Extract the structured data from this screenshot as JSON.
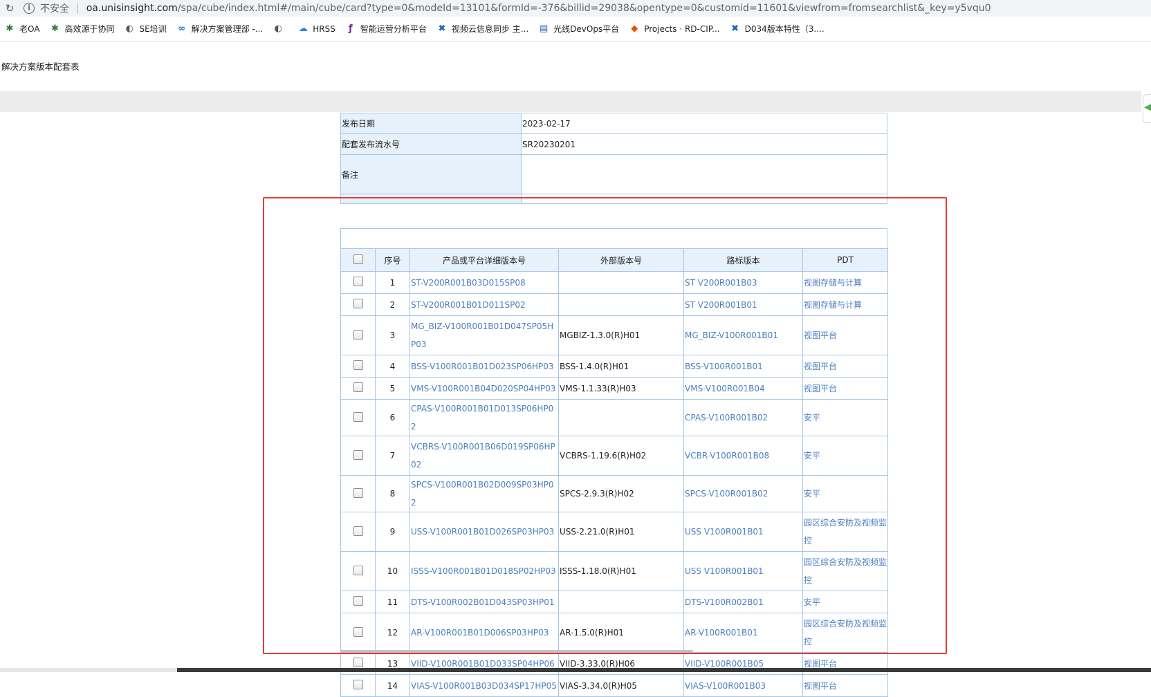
{
  "browser": {
    "insecure_label": "不安全",
    "url_host": "oa.unisinsight.com",
    "url_path": "/spa/cube/index.html#/main/cube/card?type=0&modeId=13101&formId=-376&billid=29038&opentype=0&customid=11601&viewfrom=fromsearchlist&_key=y5vqu0",
    "bookmarks": [
      {
        "label": "老OA",
        "icon": "gear-green-icon"
      },
      {
        "label": "高效源于协同",
        "icon": "gear-green-icon"
      },
      {
        "label": "SE培训",
        "icon": "globe-icon"
      },
      {
        "label": "解决方案管理部 -...",
        "icon": "infinity-icon"
      },
      {
        "label": "",
        "icon": "globe-icon"
      },
      {
        "label": "HRSS",
        "icon": "cloud-icon"
      },
      {
        "label": "智能运营分析平台",
        "icon": "brand-icon"
      },
      {
        "label": "视频云信息同步 主...",
        "icon": "confluence-icon"
      },
      {
        "label": "光线DevOps平台",
        "icon": "doc-icon"
      },
      {
        "label": "Projects · RD-CIP...",
        "icon": "gitlab-icon"
      },
      {
        "label": "D034版本特性（3....",
        "icon": "confluence-icon"
      }
    ]
  },
  "page": {
    "title": "解决方案版本配套表"
  },
  "info": {
    "rows": [
      {
        "label": "发布日期",
        "value": "2023-02-17"
      },
      {
        "label": "配套发布流水号",
        "value": "SR20230201"
      },
      {
        "label": "备注",
        "value": ""
      }
    ]
  },
  "detail": {
    "headers": [
      "序号",
      "产品或平台详细版本号",
      "外部版本号",
      "路标版本",
      "PDT"
    ],
    "rows": [
      {
        "no": "1",
        "product": "ST-V200R001B03D015SP08",
        "external": "",
        "roadmap": "ST V200R001B03",
        "pdt": "视图存储与计算"
      },
      {
        "no": "2",
        "product": "ST-V200R001B01D011SP02",
        "external": "",
        "roadmap": "ST V200R001B01",
        "pdt": "视图存储与计算"
      },
      {
        "no": "3",
        "product": "MG_BIZ-V100R001B01D047SP05HP03",
        "external": "MGBIZ-1.3.0(R)H01",
        "roadmap": "MG_BIZ-V100R001B01",
        "pdt": "视图平台"
      },
      {
        "no": "4",
        "product": "BSS-V100R001B01D023SP06HP03",
        "external": "BSS-1.4.0(R)H01",
        "roadmap": "BSS-V100R001B01",
        "pdt": "视图平台"
      },
      {
        "no": "5",
        "product": "VMS-V100R001B04D020SP04HP03",
        "external": "VMS-1.1.33(R)H03",
        "roadmap": "VMS-V100R001B04",
        "pdt": "视图平台"
      },
      {
        "no": "6",
        "product": "CPAS-V100R001B01D013SP06HP02",
        "external": "",
        "roadmap": "CPAS-V100R001B02",
        "pdt": "安平"
      },
      {
        "no": "7",
        "product": "VCBRS-V100R001B06D019SP06HP02",
        "external": "VCBRS-1.19.6(R)H02",
        "roadmap": "VCBR-V100R001B08",
        "pdt": "安平"
      },
      {
        "no": "8",
        "product": "SPCS-V100R001B02D009SP03HP02",
        "external": "SPCS-2.9.3(R)H02",
        "roadmap": "SPCS-V100R001B02",
        "pdt": "安平"
      },
      {
        "no": "9",
        "product": "USS-V100R001B01D026SP03HP03",
        "external": "USS-2.21.0(R)H01",
        "roadmap": "USS V100R001B01",
        "pdt": "园区综合安防及视频监控"
      },
      {
        "no": "10",
        "product": "ISSS-V100R001B01D018SP02HP03",
        "external": "ISSS-1.18.0(R)H01",
        "roadmap": "USS V100R001B01",
        "pdt": "园区综合安防及视频监控"
      },
      {
        "no": "11",
        "product": "DTS-V100R002B01D043SP03HP01",
        "external": "",
        "roadmap": "DTS-V100R002B01",
        "pdt": "安平"
      },
      {
        "no": "12",
        "product": "AR-V100R001B01D006SP03HP03",
        "external": "AR-1.5.0(R)H01",
        "roadmap": "AR-V100R001B01",
        "pdt": "园区综合安防及视频监控"
      },
      {
        "no": "13",
        "product": "VIID-V100R001B01D033SP04HP06",
        "external": "VIID-3.33.0(R)H06",
        "roadmap": "VIID-V100R001B05",
        "pdt": "视图平台"
      },
      {
        "no": "14",
        "product": "VIAS-V100R001B03D034SP17HP05",
        "external": "VIAS-3.34.0(R)H05",
        "roadmap": "VIAS-V100R001B03",
        "pdt": "视图平台"
      }
    ]
  },
  "colors": {
    "link": "#4a7fc1",
    "header_bg": "#e6f1fb",
    "border": "#a7c7e3",
    "highlight_box": "#e53935"
  }
}
